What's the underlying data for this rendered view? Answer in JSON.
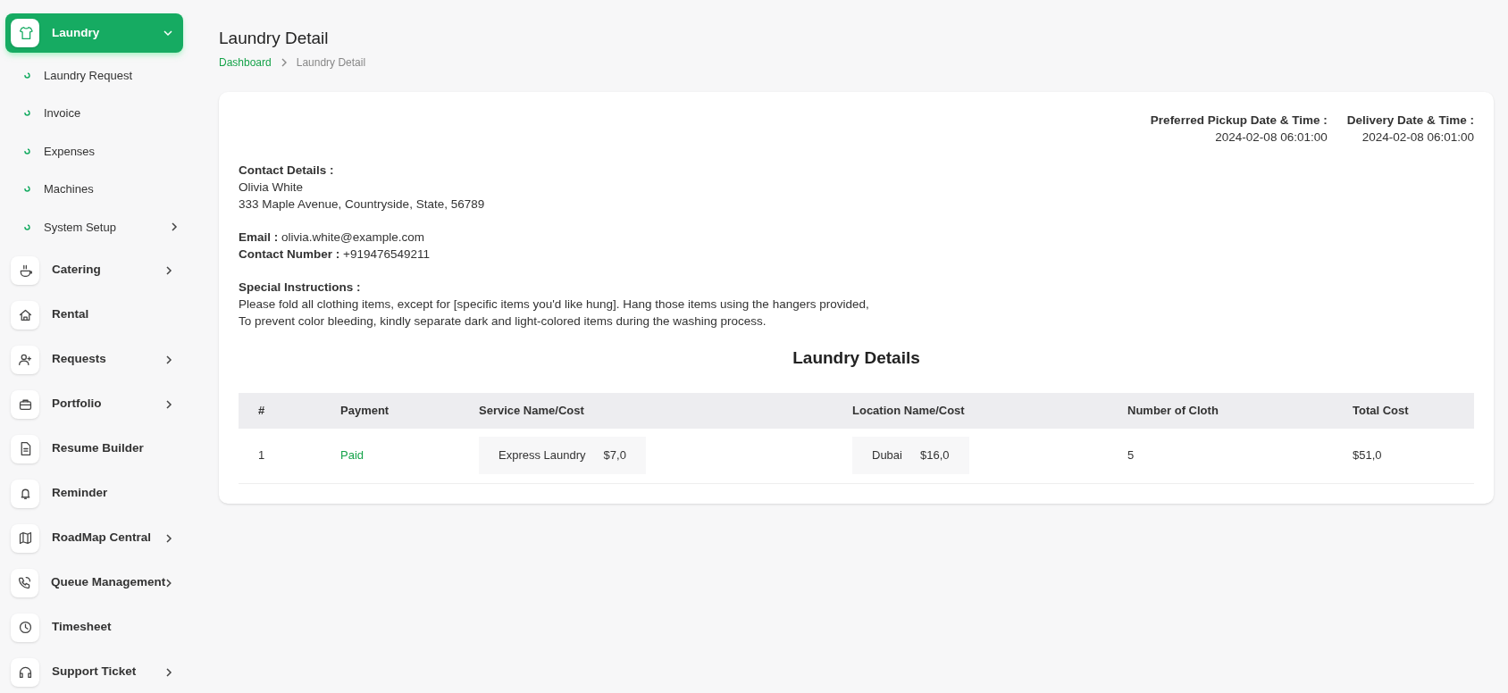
{
  "sidebar": {
    "items": [
      {
        "label": "Laundry",
        "selected": true,
        "expanded": true,
        "submenu": true,
        "children": [
          {
            "label": "Laundry Request",
            "submenu": false
          },
          {
            "label": "Invoice",
            "submenu": false
          },
          {
            "label": "Expenses",
            "submenu": false
          },
          {
            "label": "Machines",
            "submenu": false
          },
          {
            "label": "System Setup",
            "submenu": true
          }
        ]
      },
      {
        "label": "Catering",
        "selected": false,
        "expanded": false,
        "submenu": true
      },
      {
        "label": "Rental",
        "selected": false,
        "expanded": false,
        "submenu": false
      },
      {
        "label": "Requests",
        "selected": false,
        "expanded": false,
        "submenu": true
      },
      {
        "label": "Portfolio",
        "selected": false,
        "expanded": false,
        "submenu": true
      },
      {
        "label": "Resume Builder",
        "selected": false,
        "expanded": false,
        "submenu": false
      },
      {
        "label": "Reminder",
        "selected": false,
        "expanded": false,
        "submenu": false
      },
      {
        "label": "RoadMap Central",
        "selected": false,
        "expanded": false,
        "submenu": true
      },
      {
        "label": "Queue Management",
        "selected": false,
        "expanded": false,
        "submenu": true
      },
      {
        "label": "Timesheet",
        "selected": false,
        "expanded": false,
        "submenu": false
      },
      {
        "label": "Support Ticket",
        "selected": false,
        "expanded": false,
        "submenu": true
      }
    ]
  },
  "page": {
    "title": "Laundry Detail",
    "breadcrumb": [
      "Dashboard",
      "Laundry Detail"
    ]
  },
  "dates": [
    {
      "label": "Preferred Pickup Date & Time :",
      "value": "2024-02-08 06:01:00"
    },
    {
      "label": "Delivery Date & Time :",
      "value": "2024-02-08 06:01:00"
    }
  ],
  "contact": {
    "heading": "Contact Details :",
    "name": "Olivia White",
    "address": "333 Maple Avenue, Countryside, State, 56789",
    "email_label": "Email :",
    "email": "olivia.white@example.com",
    "phone_label": "Contact Number :",
    "phone": "+919476549211"
  },
  "instructions": {
    "heading": "Special Instructions :",
    "lines": [
      "Please fold all clothing items, except for [specific items you'd like hung]. Hang those items using the hangers provided,",
      "To prevent color bleeding, kindly separate dark and light-colored items during the washing process."
    ]
  },
  "table": {
    "title": "Laundry Details",
    "columns": [
      "#",
      "Payment",
      "Service Name/Cost",
      "Location Name/Cost",
      "Number of Cloth",
      "Total Cost"
    ],
    "rows": [
      {
        "number": "1",
        "payment": "Paid",
        "service": {
          "name": "Express Laundry",
          "cost": "$7,0"
        },
        "location": {
          "name": "Dubai",
          "cost": "$16,0"
        },
        "cloth": "5",
        "total": "$51,0"
      }
    ]
  }
}
